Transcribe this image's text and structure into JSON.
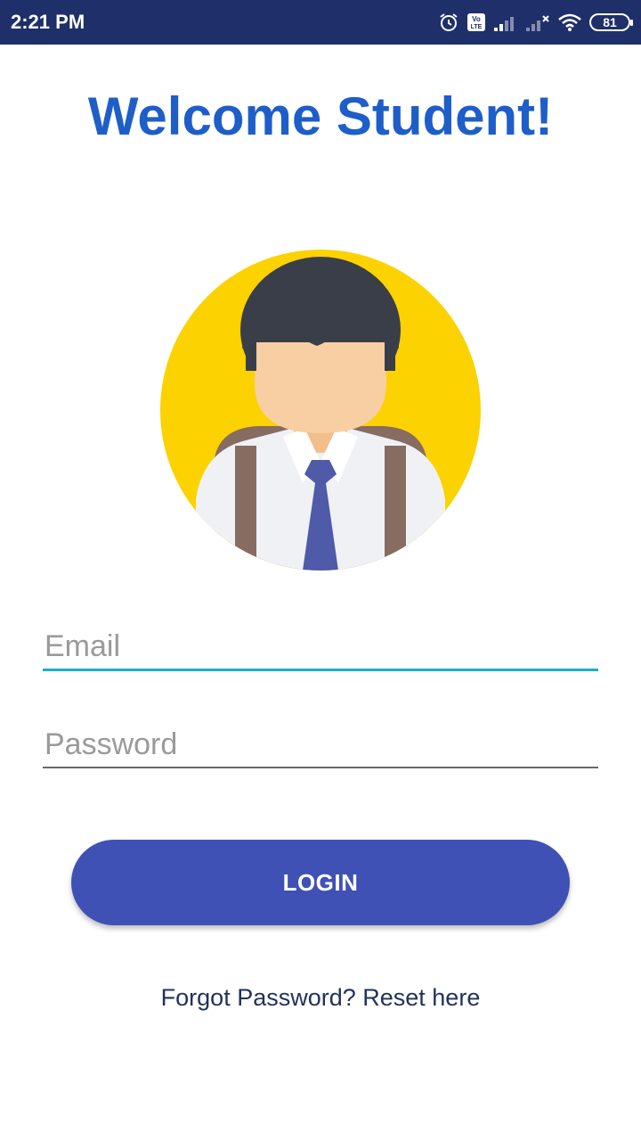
{
  "status_bar": {
    "time": "2:21 PM",
    "battery_level": "81",
    "icons": [
      "alarm-icon",
      "volte-icon",
      "signal-icon",
      "signal-no-service-icon",
      "wifi-icon",
      "battery-icon"
    ]
  },
  "title": "Welcome Student!",
  "avatar": {
    "icon": "student-avatar-icon"
  },
  "form": {
    "email_placeholder": "Email",
    "email_value": "",
    "password_placeholder": "Password",
    "password_value": ""
  },
  "login_label": "LOGIN",
  "forgot_text": "Forgot Password? Reset here",
  "colors": {
    "status_bar": "#1f2f6a",
    "title": "#1e5ec8",
    "accent_underline": "#1ab0c9",
    "button": "#3f51b5",
    "avatar_background": "#fcd200"
  }
}
